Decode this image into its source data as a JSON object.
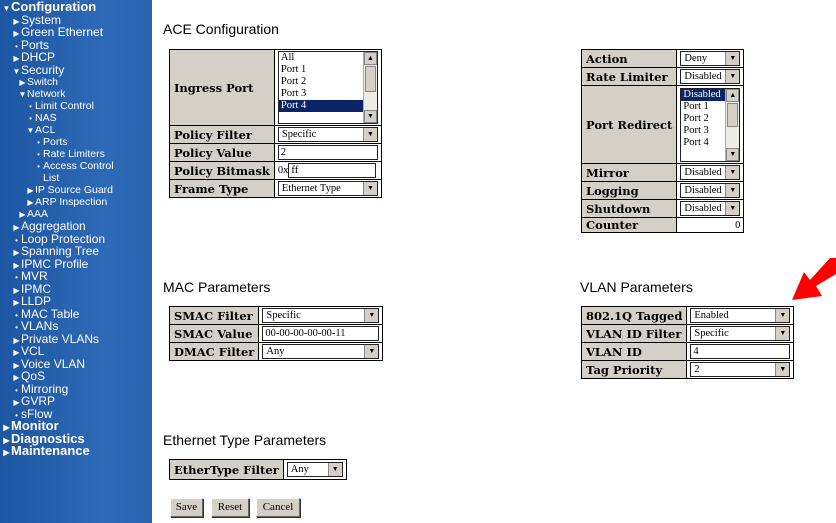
{
  "sidebar": {
    "items": [
      {
        "label": "Configuration",
        "level": 0,
        "marker": "▼",
        "bold": true
      },
      {
        "label": "System",
        "level": 1,
        "marker": "▶"
      },
      {
        "label": "Green Ethernet",
        "level": 1,
        "marker": "▶"
      },
      {
        "label": "Ports",
        "level": 1,
        "marker": "•"
      },
      {
        "label": "DHCP",
        "level": 1,
        "marker": "▶"
      },
      {
        "label": "Security",
        "level": 1,
        "marker": "▼"
      },
      {
        "label": "Switch",
        "level": 2,
        "marker": "▶",
        "small": true
      },
      {
        "label": "Network",
        "level": 2,
        "marker": "▼",
        "small": true
      },
      {
        "label": "Limit Control",
        "level": 3,
        "marker": "•",
        "small": true
      },
      {
        "label": "NAS",
        "level": 3,
        "marker": "•",
        "small": true
      },
      {
        "label": "ACL",
        "level": 3,
        "marker": "▼",
        "small": true
      },
      {
        "label": "Ports",
        "level": 4,
        "marker": "•",
        "small": true
      },
      {
        "label": "Rate Limiters",
        "level": 4,
        "marker": "•",
        "small": true
      },
      {
        "label": "Access Control",
        "level": 4,
        "marker": "•",
        "small": true
      },
      {
        "label": "List",
        "level": 4,
        "marker": "",
        "small": true
      },
      {
        "label": "IP Source Guard",
        "level": 3,
        "marker": "▶",
        "small": true
      },
      {
        "label": "ARP Inspection",
        "level": 3,
        "marker": "▶",
        "small": true
      },
      {
        "label": "AAA",
        "level": 2,
        "marker": "▶",
        "small": true
      },
      {
        "label": "Aggregation",
        "level": 1,
        "marker": "▶"
      },
      {
        "label": "Loop Protection",
        "level": 1,
        "marker": "•"
      },
      {
        "label": "Spanning Tree",
        "level": 1,
        "marker": "▶"
      },
      {
        "label": "IPMC Profile",
        "level": 1,
        "marker": "▶"
      },
      {
        "label": "MVR",
        "level": 1,
        "marker": "•"
      },
      {
        "label": "IPMC",
        "level": 1,
        "marker": "▶"
      },
      {
        "label": "LLDP",
        "level": 1,
        "marker": "▶"
      },
      {
        "label": "MAC Table",
        "level": 1,
        "marker": "•"
      },
      {
        "label": "VLANs",
        "level": 1,
        "marker": "•"
      },
      {
        "label": "Private VLANs",
        "level": 1,
        "marker": "▶"
      },
      {
        "label": "VCL",
        "level": 1,
        "marker": "▶"
      },
      {
        "label": "Voice VLAN",
        "level": 1,
        "marker": "▶"
      },
      {
        "label": "QoS",
        "level": 1,
        "marker": "▶"
      },
      {
        "label": "Mirroring",
        "level": 1,
        "marker": "•"
      },
      {
        "label": "GVRP",
        "level": 1,
        "marker": "▶"
      },
      {
        "label": "sFlow",
        "level": 1,
        "marker": "•"
      },
      {
        "label": "Monitor",
        "level": 0,
        "marker": "▶",
        "bold": true
      },
      {
        "label": "Diagnostics",
        "level": 0,
        "marker": "▶",
        "bold": true
      },
      {
        "label": "Maintenance",
        "level": 0,
        "marker": "▶",
        "bold": true
      }
    ]
  },
  "ace": {
    "title": "ACE Configuration",
    "ingress_port_label": "Ingress Port",
    "ingress_port_options": [
      "All",
      "Port 1",
      "Port 2",
      "Port 3",
      "Port 4"
    ],
    "ingress_port_selected": "Port 4",
    "policy_filter_label": "Policy Filter",
    "policy_filter_value": "Specific",
    "policy_value_label": "Policy Value",
    "policy_value": "2",
    "policy_bitmask_label": "Policy Bitmask",
    "policy_bitmask_prefix": "0x",
    "policy_bitmask_value": "ff",
    "frame_type_label": "Frame Type",
    "frame_type_value": "Ethernet Type"
  },
  "action": {
    "action_label": "Action",
    "action_value": "Deny",
    "rate_limiter_label": "Rate Limiter",
    "rate_limiter_value": "Disabled",
    "port_redirect_label": "Port Redirect",
    "port_redirect_options": [
      "Disabled",
      "Port 1",
      "Port 2",
      "Port 3",
      "Port 4"
    ],
    "port_redirect_selected": "Disabled",
    "mirror_label": "Mirror",
    "mirror_value": "Disabled",
    "logging_label": "Logging",
    "logging_value": "Disabled",
    "shutdown_label": "Shutdown",
    "shutdown_value": "Disabled",
    "counter_label": "Counter",
    "counter_value": "0"
  },
  "mac": {
    "title": "MAC Parameters",
    "smac_filter_label": "SMAC Filter",
    "smac_filter_value": "Specific",
    "smac_value_label": "SMAC Value",
    "smac_value": "00-00-00-00-00-11",
    "dmac_filter_label": "DMAC Filter",
    "dmac_filter_value": "Any"
  },
  "vlan": {
    "title": "VLAN Parameters",
    "tagged_label": "802.1Q Tagged",
    "tagged_value": "Enabled",
    "vlan_id_filter_label": "VLAN ID Filter",
    "vlan_id_filter_value": "Specific",
    "vlan_id_label": "VLAN ID",
    "vlan_id_value": "4",
    "tag_priority_label": "Tag Priority",
    "tag_priority_value": "2"
  },
  "ethertype": {
    "title": "Ethernet Type Parameters",
    "filter_label": "EtherType Filter",
    "filter_value": "Any"
  },
  "buttons": {
    "save": "Save",
    "reset": "Reset",
    "cancel": "Cancel"
  },
  "colors": {
    "sidebar": "#2e6ab8",
    "label_bg": "#d4d0c8",
    "selected_option": "#0a246a",
    "annotation_arrow": "#ff0000"
  },
  "icons": {
    "dropdown": "dropdown-arrow-icon",
    "annotation": "red-arrow-icon"
  }
}
